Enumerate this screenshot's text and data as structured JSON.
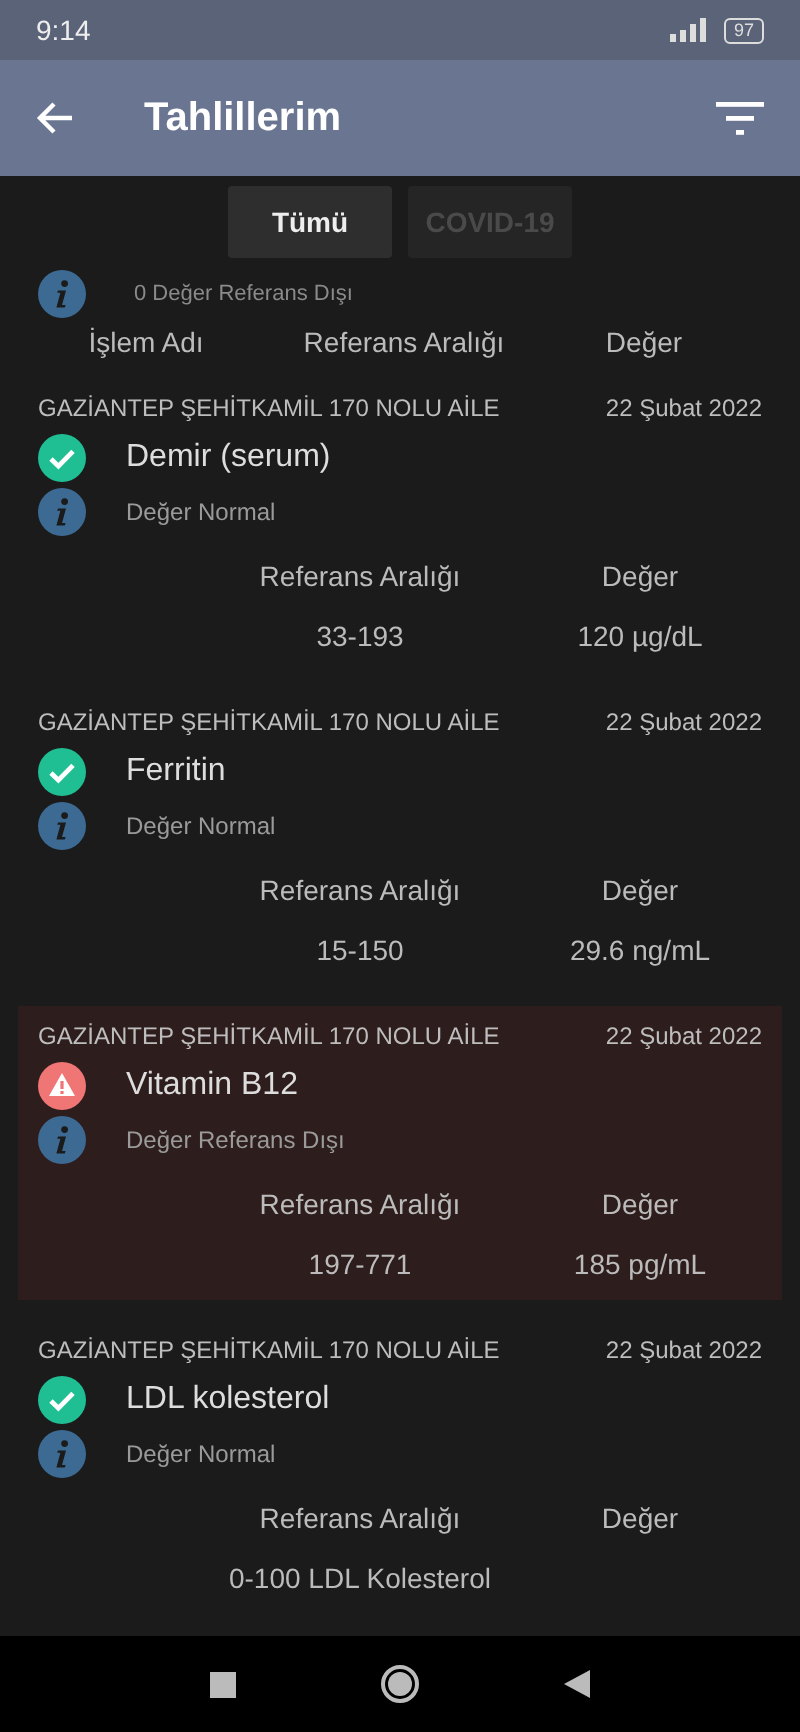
{
  "status_bar": {
    "time": "9:14",
    "battery": "97"
  },
  "app_bar": {
    "title": "Tahlillerim"
  },
  "tabs": [
    {
      "label": "Tümü",
      "selected": true
    },
    {
      "label": "COVID-19",
      "selected": false
    }
  ],
  "partial_card": {
    "note": "0 Değer Referans Dışı",
    "columns": [
      "İşlem Adı",
      "Referans Aralığı",
      "Değer"
    ]
  },
  "results": [
    {
      "facility": "GAZİANTEP ŞEHİTKAMİL 170 NOLU AİLE",
      "date": "22 Şubat 2022",
      "name": "Demir (serum)",
      "kind": "normal",
      "note": "Değer Normal",
      "range_label": "Referans Aralığı",
      "value_label": "Değer",
      "range": "33-193",
      "value": "120 µg/dL"
    },
    {
      "facility": "GAZİANTEP ŞEHİTKAMİL 170 NOLU AİLE",
      "date": "22 Şubat 2022",
      "name": "Ferritin",
      "kind": "normal",
      "note": "Değer Normal",
      "range_label": "Referans Aralığı",
      "value_label": "Değer",
      "range": "15-150",
      "value": "29.6 ng/mL"
    },
    {
      "facility": "GAZİANTEP ŞEHİTKAMİL 170 NOLU AİLE",
      "date": "22 Şubat 2022",
      "name": "Vitamin B12",
      "kind": "out_of_range",
      "note": "Değer Referans Dışı",
      "range_label": "Referans Aralığı",
      "value_label": "Değer",
      "range": "197-771",
      "value": "185 pg/mL"
    },
    {
      "facility": "GAZİANTEP ŞEHİTKAMİL 170 NOLU AİLE",
      "date": "22 Şubat 2022",
      "name": "LDL kolesterol",
      "kind": "normal",
      "note": "Değer Normal",
      "range_label": "Referans Aralığı",
      "value_label": "Değer",
      "range": "0-100 LDL Kolesterol"
    }
  ]
}
